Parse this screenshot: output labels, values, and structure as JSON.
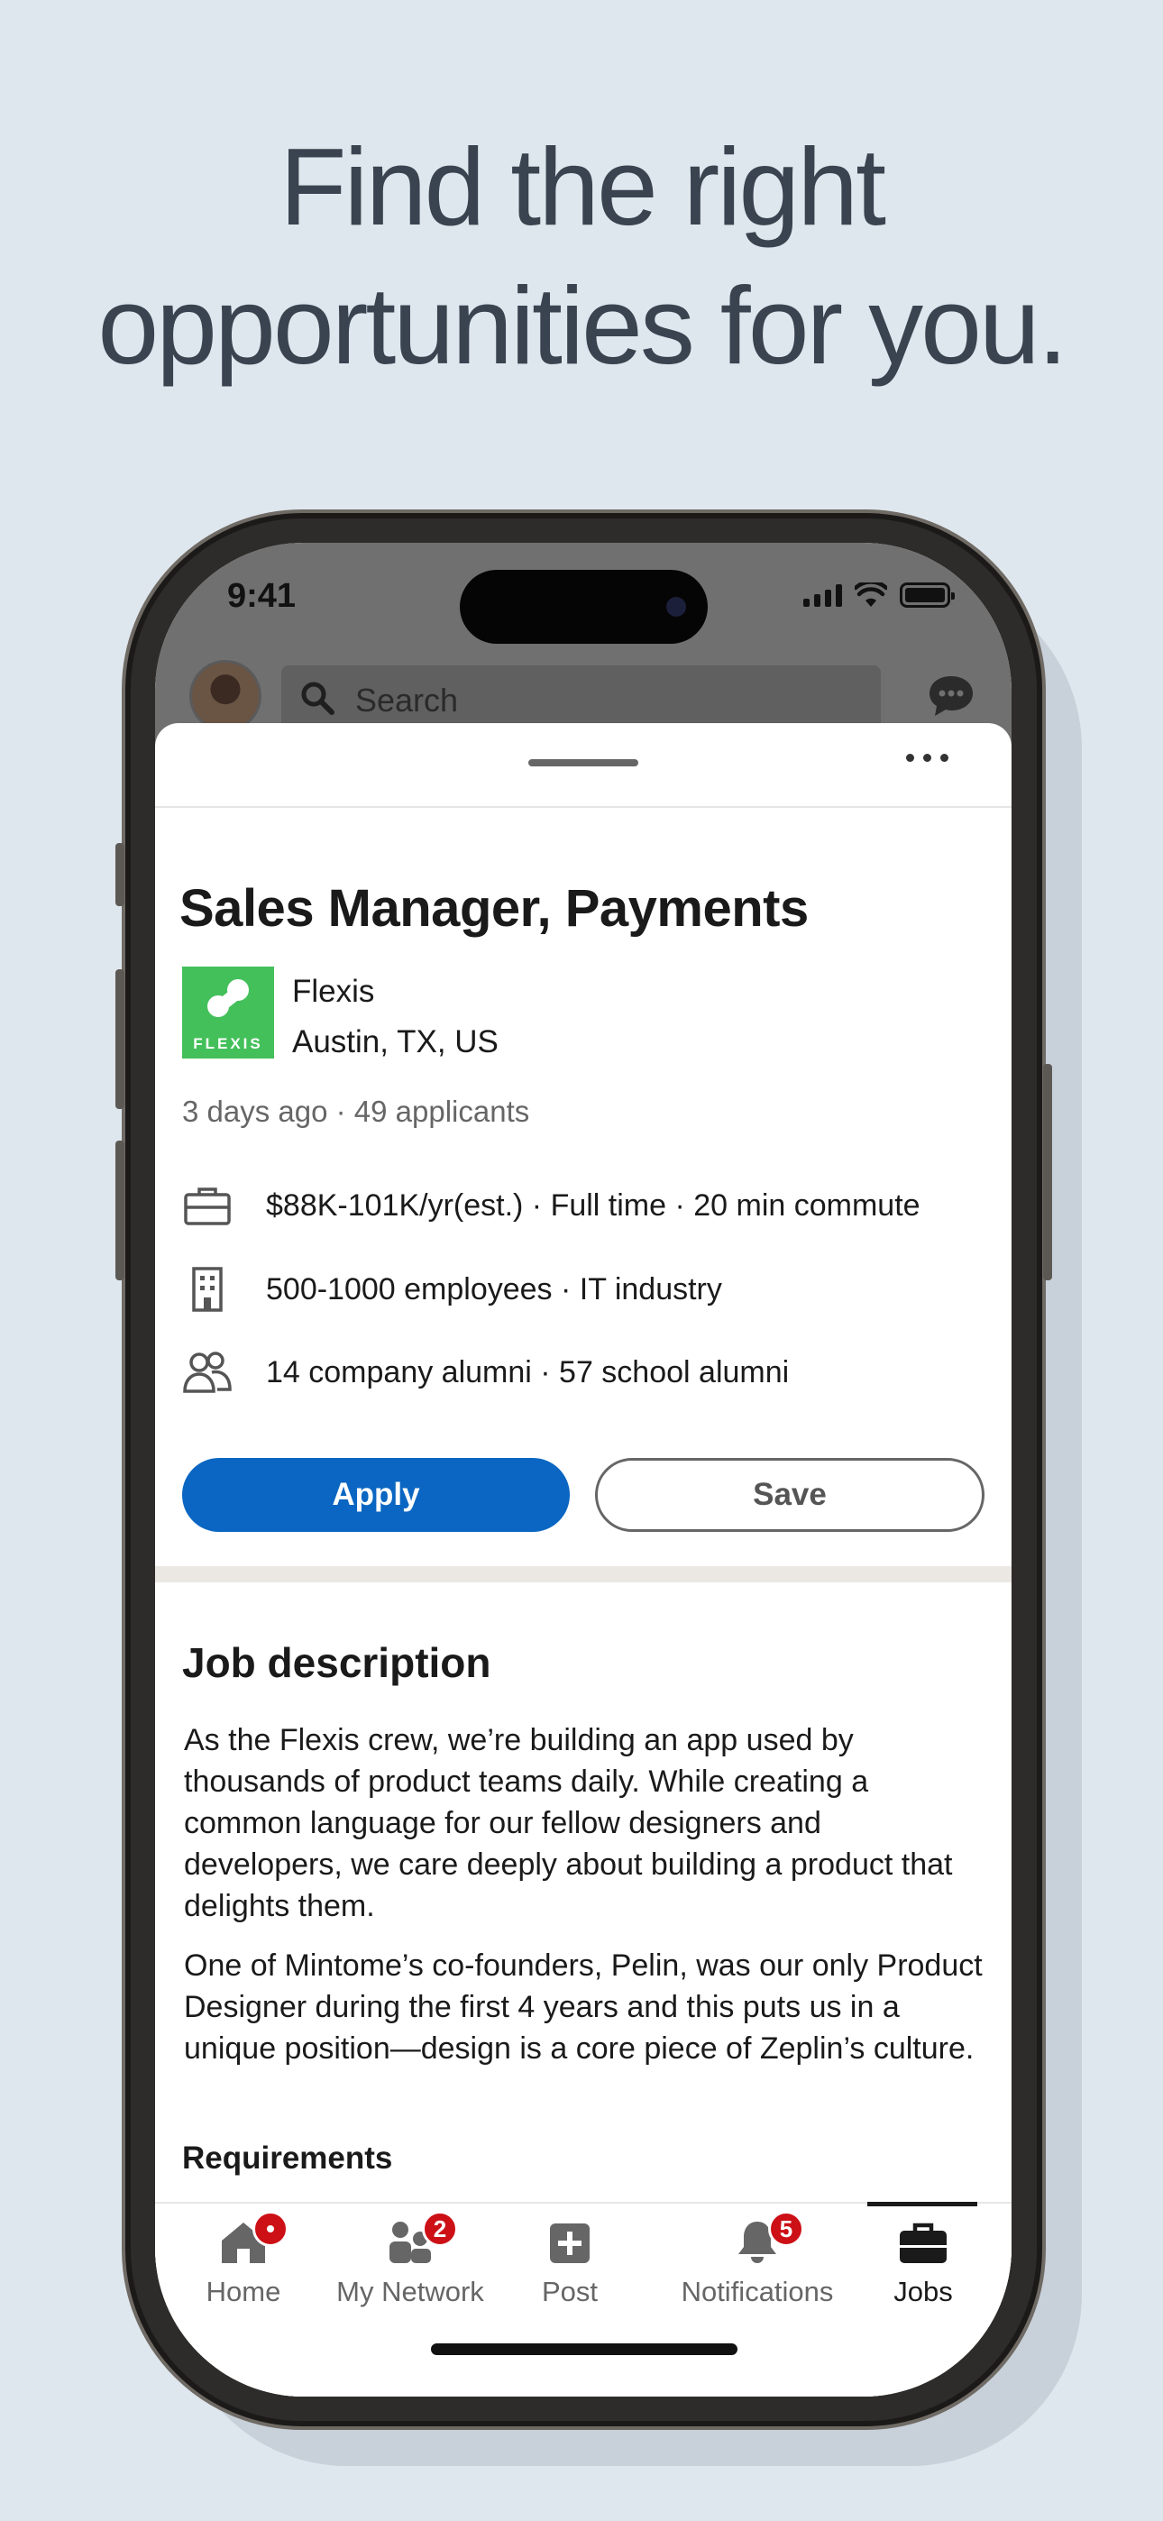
{
  "headline": {
    "line1": "Find the right",
    "line2": "opportunities for you."
  },
  "status_bar": {
    "time": "9:41"
  },
  "app_header": {
    "search_placeholder": "Search",
    "icons": [
      "avatar",
      "search-icon",
      "messaging-icon"
    ]
  },
  "job": {
    "title": "Sales Manager, Payments",
    "company": "Flexis",
    "company_logo_text": "FLEXIS",
    "location": "Austin, TX, US",
    "meta": "3 days ago · 49 applicants",
    "details": [
      {
        "icon": "briefcase-icon",
        "text": "$88K-101K/yr(est.) · Full time · 20 min commute"
      },
      {
        "icon": "building-icon",
        "text": "500-1000 employees · IT industry"
      },
      {
        "icon": "people-icon",
        "text": "14 company alumni · 57 school alumni"
      }
    ],
    "apply_label": "Apply",
    "save_label": "Save"
  },
  "description": {
    "title": "Job description",
    "paragraphs": [
      "As the Flexis crew, we’re building an app used by thousands of product teams daily. While creating a common language for our fellow designers and developers, we care deeply about building a product that delights them.",
      "One of Mintome’s co-founders, Pelin, was our only Product Designer during the first 4 years and this puts us in a unique position—design is a core piece of Zeplin’s culture."
    ],
    "requirements_heading": "Requirements"
  },
  "tabbar": {
    "tabs": [
      {
        "label": "Home",
        "icon": "home-icon",
        "badge": "dot"
      },
      {
        "label": "My Network",
        "icon": "network-icon",
        "badge": "2"
      },
      {
        "label": "Post",
        "icon": "post-icon",
        "badge": ""
      },
      {
        "label": "Notifications",
        "icon": "bell-icon",
        "badge": "5"
      },
      {
        "label": "Jobs",
        "icon": "jobs-icon",
        "badge": "",
        "active": true
      }
    ]
  },
  "colors": {
    "page_background": "#dfe7ee",
    "primary_blue": "#0a66c2",
    "badge_red": "#cc1016",
    "logo_green": "#43c05a"
  }
}
